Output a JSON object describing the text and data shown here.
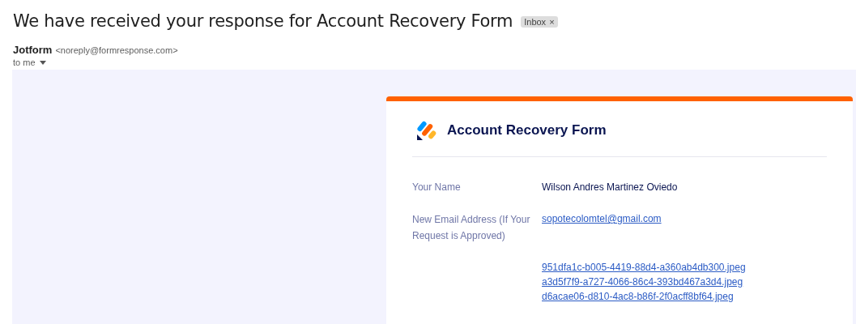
{
  "subject": "We have received your response for Account Recovery Form",
  "labels": [
    {
      "text": "Inbox",
      "remove": "×"
    }
  ],
  "sender": {
    "name": "Jotform",
    "address": "<noreply@formresponse.com>"
  },
  "recipient": "to me",
  "form": {
    "title": "Account Recovery Form",
    "fields": [
      {
        "label": "Your Name",
        "kind": "text",
        "values": [
          "Wilson Andres Martinez Oviedo"
        ]
      },
      {
        "label": "New Email Address (If Your Request is Approved)",
        "kind": "link",
        "values": [
          "sopotecolomtel@gmail.com"
        ]
      },
      {
        "kind": "link",
        "values": [
          "951dfa1c-b005-4419-88d4-a360ab4db300.jpeg",
          "a3d5f7f9-a727-4066-86c4-393bd467a3d4.jpeg",
          "d6acae06-d810-4ac8-b86f-2f0acff8bf64.jpeg"
        ]
      }
    ]
  }
}
